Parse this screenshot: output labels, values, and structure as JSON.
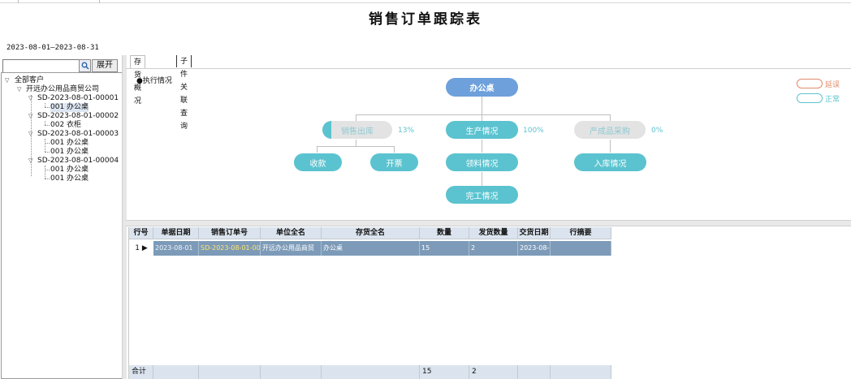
{
  "page": {
    "title": "销售订单跟踪表",
    "date_range": "2023-08-01—2023-08-31"
  },
  "search": {
    "value": "",
    "placeholder": ""
  },
  "toolbar": {
    "expand_label": "展开"
  },
  "tree": {
    "root": "全部客户",
    "customer": "开远办公用品商贸公司",
    "orders": [
      {
        "no": "SD-2023-08-01-00001",
        "items": [
          "001 办公桌"
        ]
      },
      {
        "no": "SD-2023-08-01-00002",
        "items": [
          "002 衣柜"
        ]
      },
      {
        "no": "SD-2023-08-01-00003",
        "items": [
          "001 办公桌",
          "001 办公桌"
        ]
      },
      {
        "no": "SD-2023-08-01-00004",
        "items": [
          "001 办公桌",
          "001 办公桌"
        ]
      }
    ]
  },
  "tabs": [
    "存货概况",
    "子件关联查询"
  ],
  "flow": {
    "section_label": "●执行情况",
    "root": "办公桌",
    "branches": [
      {
        "label": "销售出库",
        "pct": "13%",
        "children": [
          "收款",
          "开票"
        ]
      },
      {
        "label": "生产情况",
        "pct": "100%",
        "children": [
          "领料情况",
          "完工情况"
        ]
      },
      {
        "label": "产成品采购",
        "pct": "0%",
        "children": [
          "入库情况"
        ]
      }
    ],
    "legend": [
      {
        "label": "延误",
        "color": "#e08a6a"
      },
      {
        "label": "正常",
        "color": "#5bc3cf"
      }
    ]
  },
  "grid": {
    "columns": [
      "行号",
      "单据日期",
      "销售订单号",
      "单位全名",
      "存货全名",
      "数量",
      "发货数量",
      "交货日期",
      "行摘要"
    ],
    "rows": [
      {
        "num": "1",
        "date": "2023-08-01",
        "order": "SD-2023-08-01-00",
        "unit": "开远办公用品商贸",
        "item": "办公桌",
        "qty": "15",
        "shipped": "2",
        "delivery": "2023-08-",
        "memo": ""
      }
    ],
    "footer": {
      "label": "合计",
      "qty": "15",
      "shipped": "2"
    }
  },
  "colors": {
    "accent": "#5bc3cf",
    "root_node": "#6ea0dc",
    "selected_row": "#7d9bb8",
    "header": "#dbe4ee"
  }
}
